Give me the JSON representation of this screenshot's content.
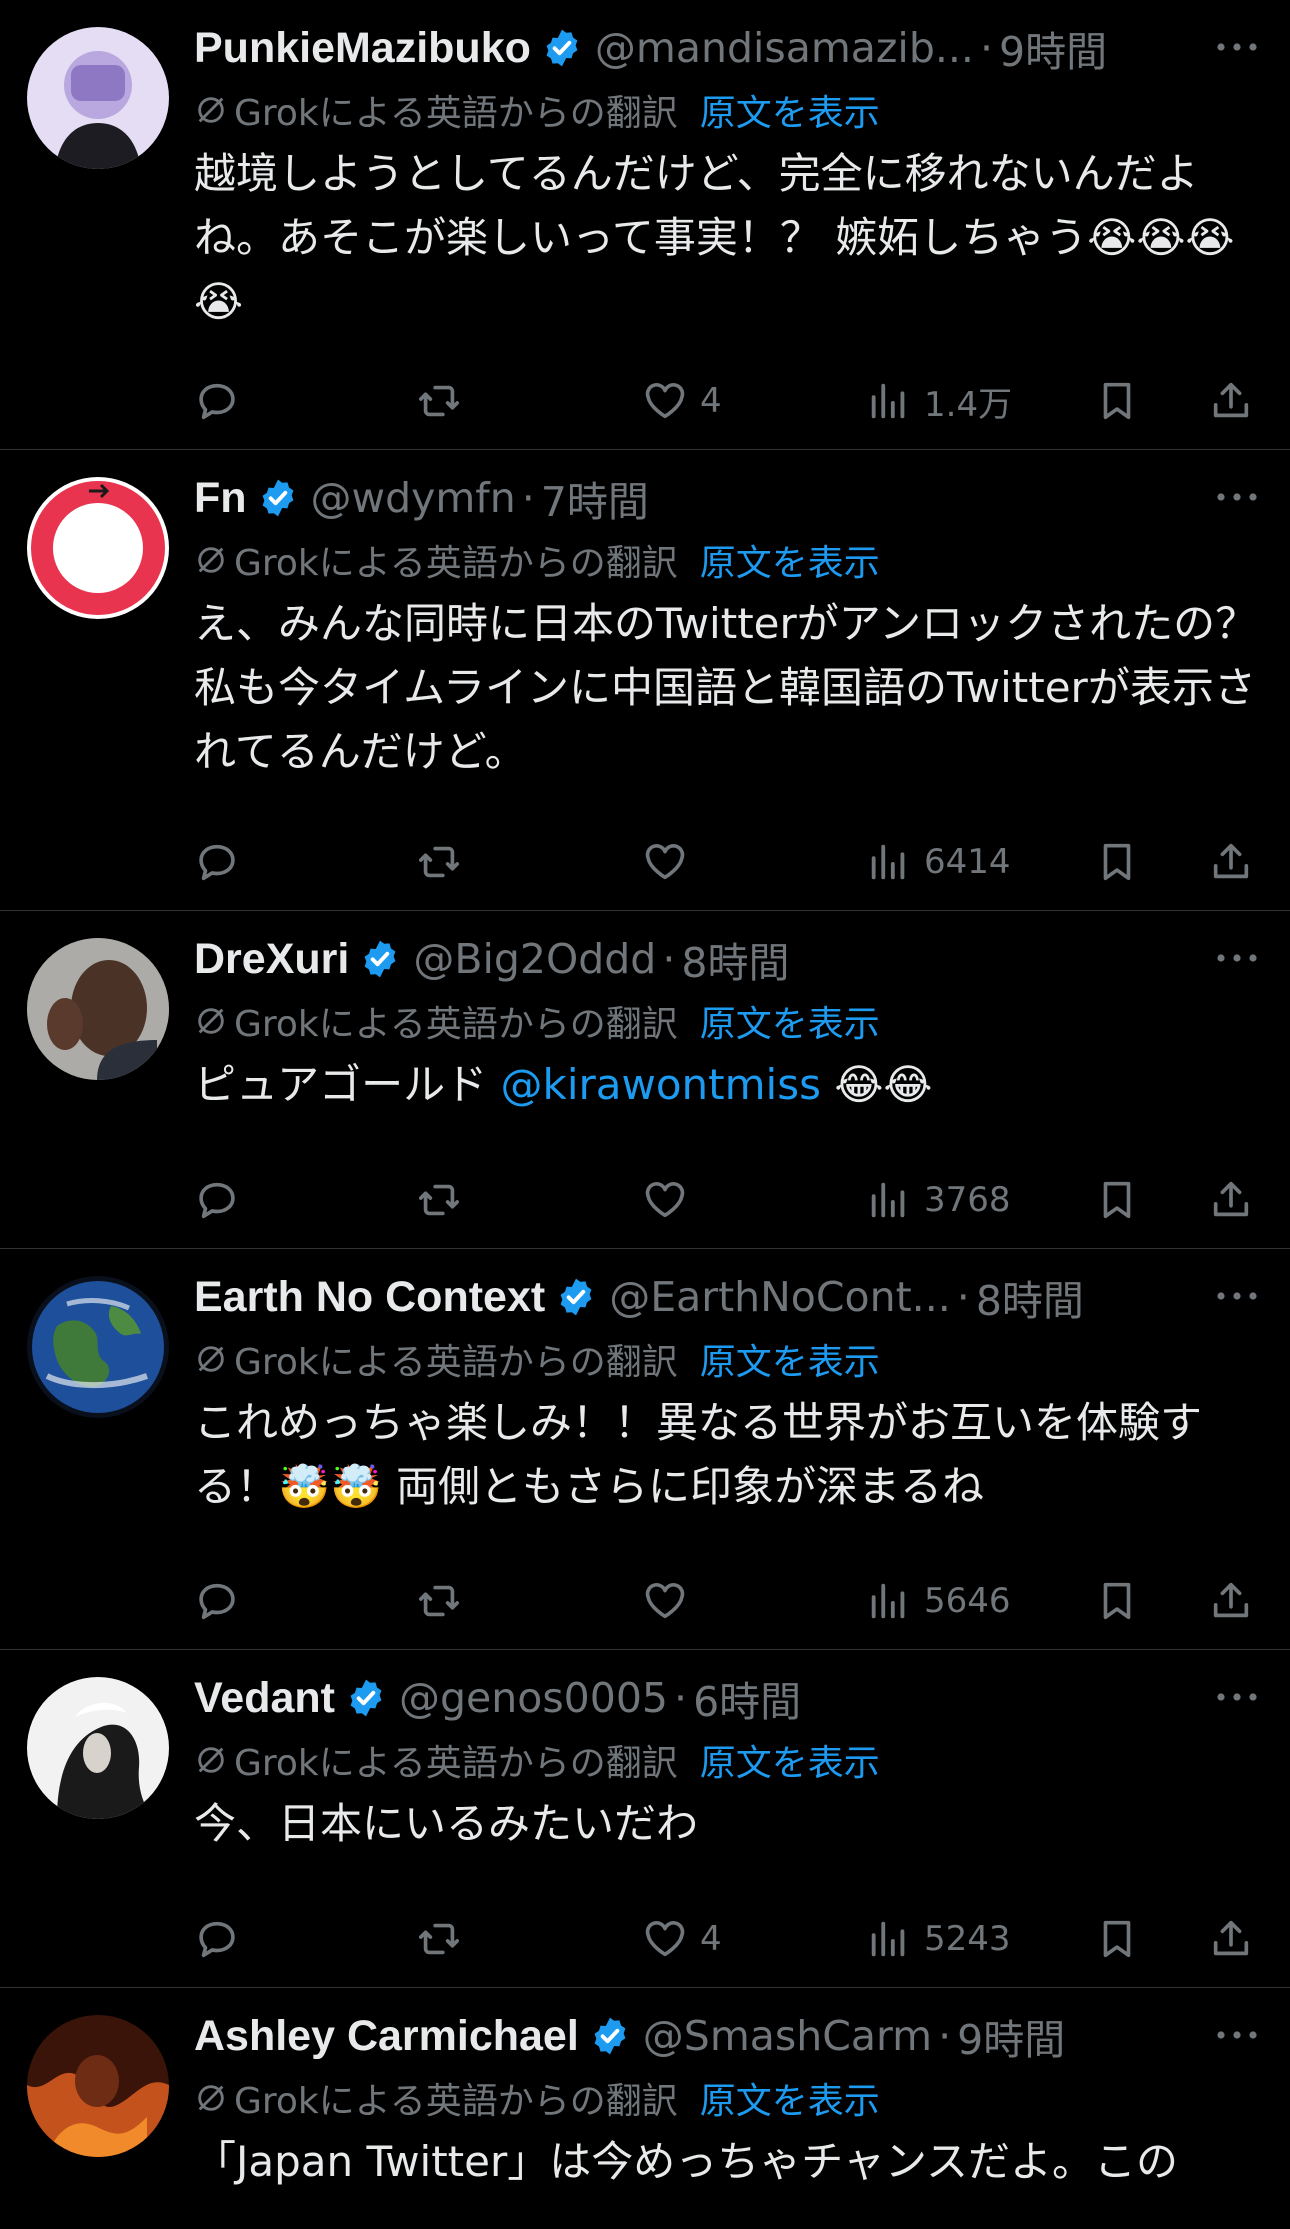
{
  "translation": {
    "label": "Grokによる英語からの翻訳",
    "show_original": "原文を表示"
  },
  "tweets": [
    {
      "name": "PunkieMazibuko",
      "handle": "@mandisamazib...",
      "time": "9時間",
      "text": "越境しようとしてるんだけど、完全に移れないんだよね。あそこが楽しいって事実！？ 嫉妬しちゃう😭😭😭😭",
      "likes": "4",
      "views": "1.4万"
    },
    {
      "name": "Fn",
      "handle": "@wdymfn",
      "time": "7時間",
      "text": "え、みんな同時に日本のTwitterがアンロックされたの？ 私も今タイムラインに中国語と韓国語のTwitterが表示されてるんだけど。",
      "likes": "",
      "views": "6414"
    },
    {
      "name": "DreXuri",
      "handle": "@Big2Oddd",
      "time": "8時間",
      "text_before": "ピュアゴールド ",
      "mention": "@kirawontmiss",
      "text_after": " 😂😂",
      "likes": "",
      "views": "3768"
    },
    {
      "name": "Earth No Context",
      "handle": "@EarthNoCont...",
      "time": "8時間",
      "text": "これめっちゃ楽しみ！！異なる世界がお互いを体験する！🤯🤯 両側ともさらに印象が深まるね",
      "likes": "",
      "views": "5646"
    },
    {
      "name": "Vedant",
      "handle": "@genos0005",
      "time": "6時間",
      "text": "今、日本にいるみたいだわ",
      "likes": "4",
      "views": "5243"
    },
    {
      "name": "Ashley Carmichael",
      "handle": "@SmashCarm",
      "time": "9時間",
      "text": "「Japan Twitter」は今めっちゃチャンスだよ。この",
      "likes": "",
      "views": ""
    }
  ],
  "colors": {
    "background": "#000000",
    "text": "#e7e9ea",
    "muted": "#71767b",
    "accent": "#1d9bf0",
    "divider": "#2f3336"
  },
  "icons": {
    "verified": "verified-badge-icon",
    "more": "more-dots-icon",
    "translate": "slashed-circle-icon",
    "reply": "reply-icon",
    "retweet": "retweet-icon",
    "like": "heart-icon",
    "views": "views-bar-icon",
    "bookmark": "bookmark-icon",
    "share": "share-icon"
  }
}
